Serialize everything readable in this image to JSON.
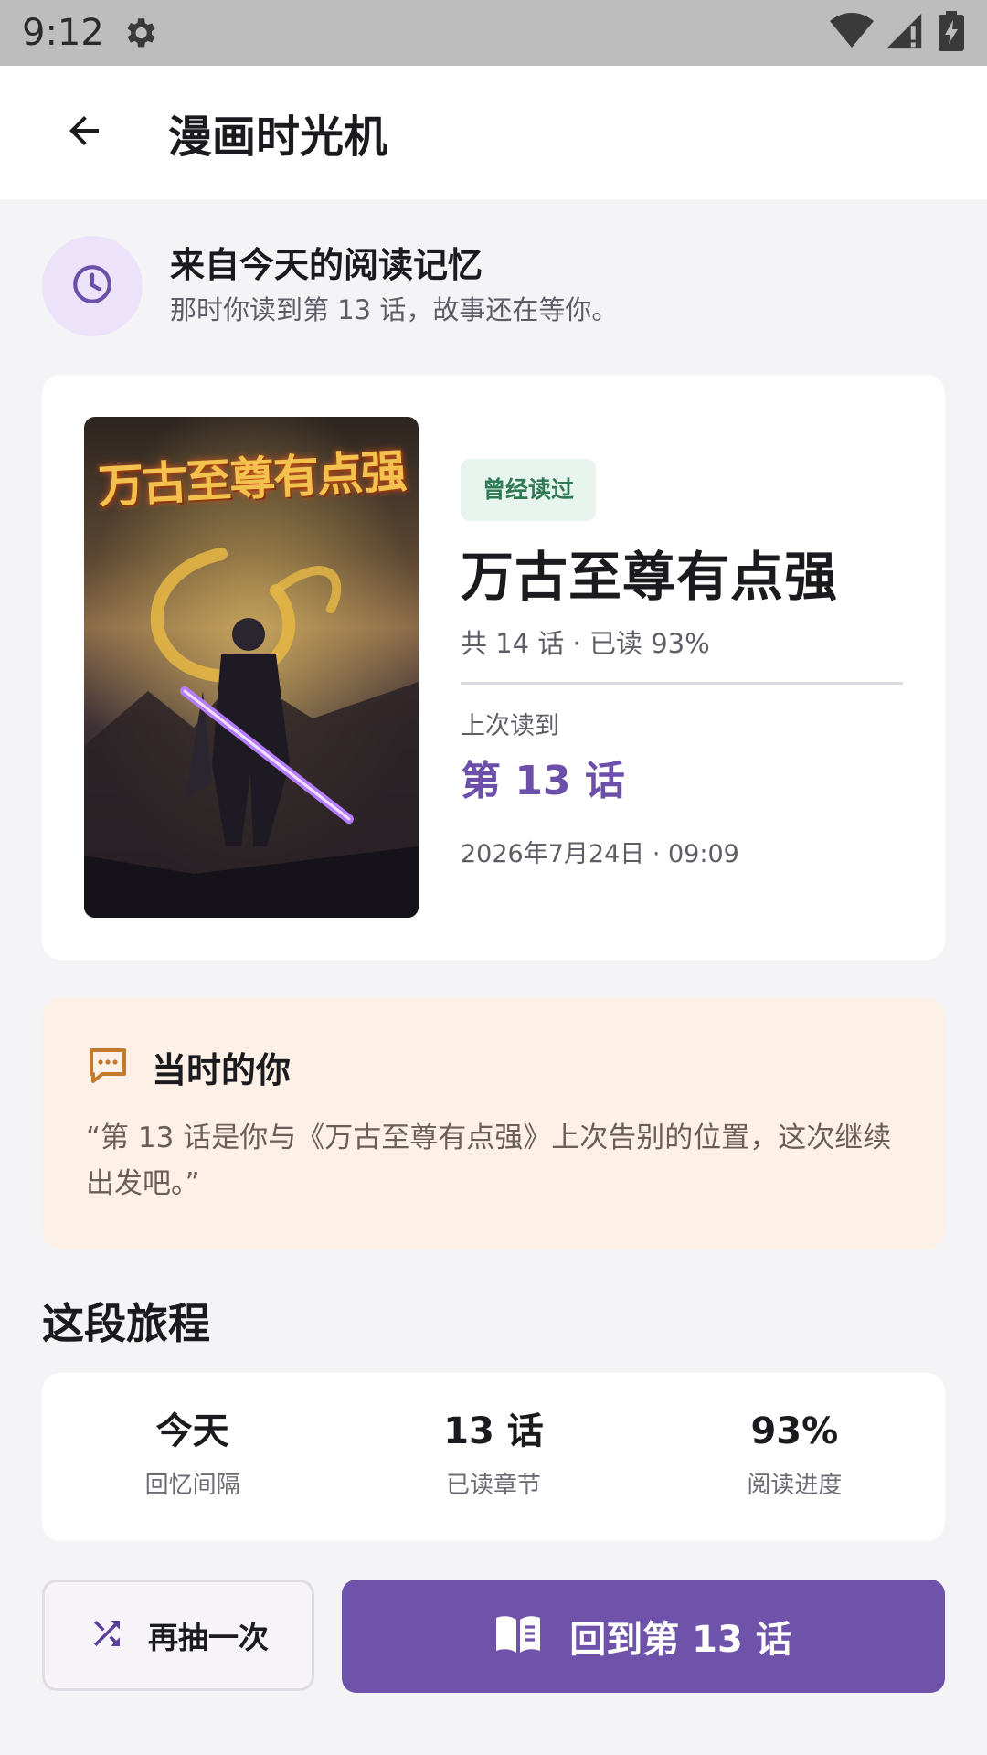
{
  "status_bar": {
    "time": "9:12",
    "icons": [
      "gear-icon",
      "wifi-icon",
      "signal-icon",
      "battery-icon"
    ]
  },
  "app_bar": {
    "title": "漫画时光机",
    "back_icon": "arrow-back-icon"
  },
  "memory": {
    "title": "来自今天的阅读记忆",
    "subtitle": "那时你读到第 13 话，故事还在等你。",
    "icon": "clock-icon"
  },
  "comic": {
    "cover_title": "万古至尊有点强",
    "badge": "曾经读过",
    "title": "万古至尊有点强",
    "meta": "共 14 话 · 已读 93%",
    "last_read_label": "上次读到",
    "last_episode": "第 13 话",
    "last_time": "2026年7月24日 · 09:09"
  },
  "you_then": {
    "title": "当时的你",
    "icon": "chat-bubble-icon",
    "quote": "“第 13 话是你与《万古至尊有点强》上次告别的位置，这次继续出发吧。”"
  },
  "journey": {
    "title": "这段旅程",
    "stats": [
      {
        "value": "今天",
        "label": "回忆间隔"
      },
      {
        "value": "13 话",
        "label": "已读章节"
      },
      {
        "value": "93%",
        "label": "阅读进度"
      }
    ]
  },
  "actions": {
    "reroll_label": "再抽一次",
    "reroll_icon": "shuffle-icon",
    "resume_label": "回到第 13 话",
    "resume_icon": "book-icon"
  },
  "colors": {
    "accent": "#6f52a9",
    "badge_bg": "#e8f5ee",
    "badge_text": "#2f7a55",
    "you_card_bg": "#fdf0e6",
    "clock_circle": "#ece3fb"
  }
}
